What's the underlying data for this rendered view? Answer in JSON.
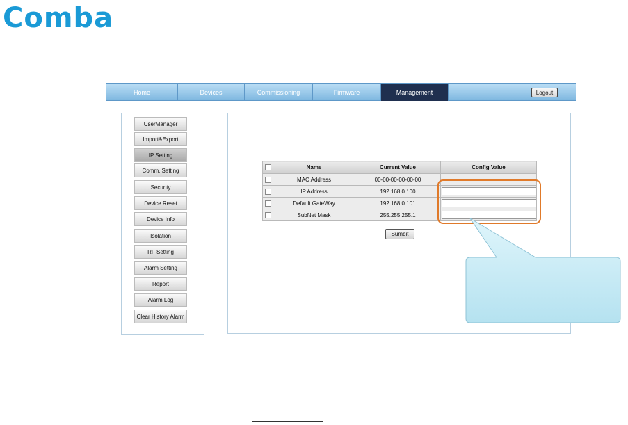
{
  "logo": {
    "text": "Comba",
    "color": "#1a9ad6"
  },
  "nav": {
    "tabs": [
      {
        "label": "Home"
      },
      {
        "label": "Devices"
      },
      {
        "label": "Commissioning"
      },
      {
        "label": "Firmware"
      },
      {
        "label": "Management",
        "active": true
      }
    ],
    "logout_label": "Logout"
  },
  "sidebar": {
    "items": [
      {
        "label": "UserManager"
      },
      {
        "label": "Import&Export"
      },
      {
        "label": "IP Setting",
        "active": true
      },
      {
        "label": "Comm. Setting"
      },
      {
        "label": "Security"
      },
      {
        "label": "Device Reset"
      },
      {
        "label": "Device Info"
      },
      {
        "label": "Isolation"
      },
      {
        "label": "RF Setting"
      },
      {
        "label": "Alarm Setting"
      },
      {
        "label": "Report"
      },
      {
        "label": "Alarm Log"
      },
      {
        "label": "Clear History Alarm"
      }
    ]
  },
  "table": {
    "headers": {
      "name": "Name",
      "current": "Current Value",
      "config": "Config Value"
    },
    "rows": [
      {
        "name": "MAC Address",
        "current": "00-00-00-00-00-00",
        "config": ""
      },
      {
        "name": "IP Address",
        "current": "192.168.0.100",
        "config": ""
      },
      {
        "name": "Default GateWay",
        "current": "192.168.0.101",
        "config": ""
      },
      {
        "name": "SubNet Mask",
        "current": "255.255.255.1",
        "config": ""
      }
    ],
    "submit_label": "Sumbit"
  },
  "colors": {
    "nav_active": "#1f2f4f",
    "highlight": "#e07a2a",
    "callout_fill": "#c6ebf5"
  }
}
